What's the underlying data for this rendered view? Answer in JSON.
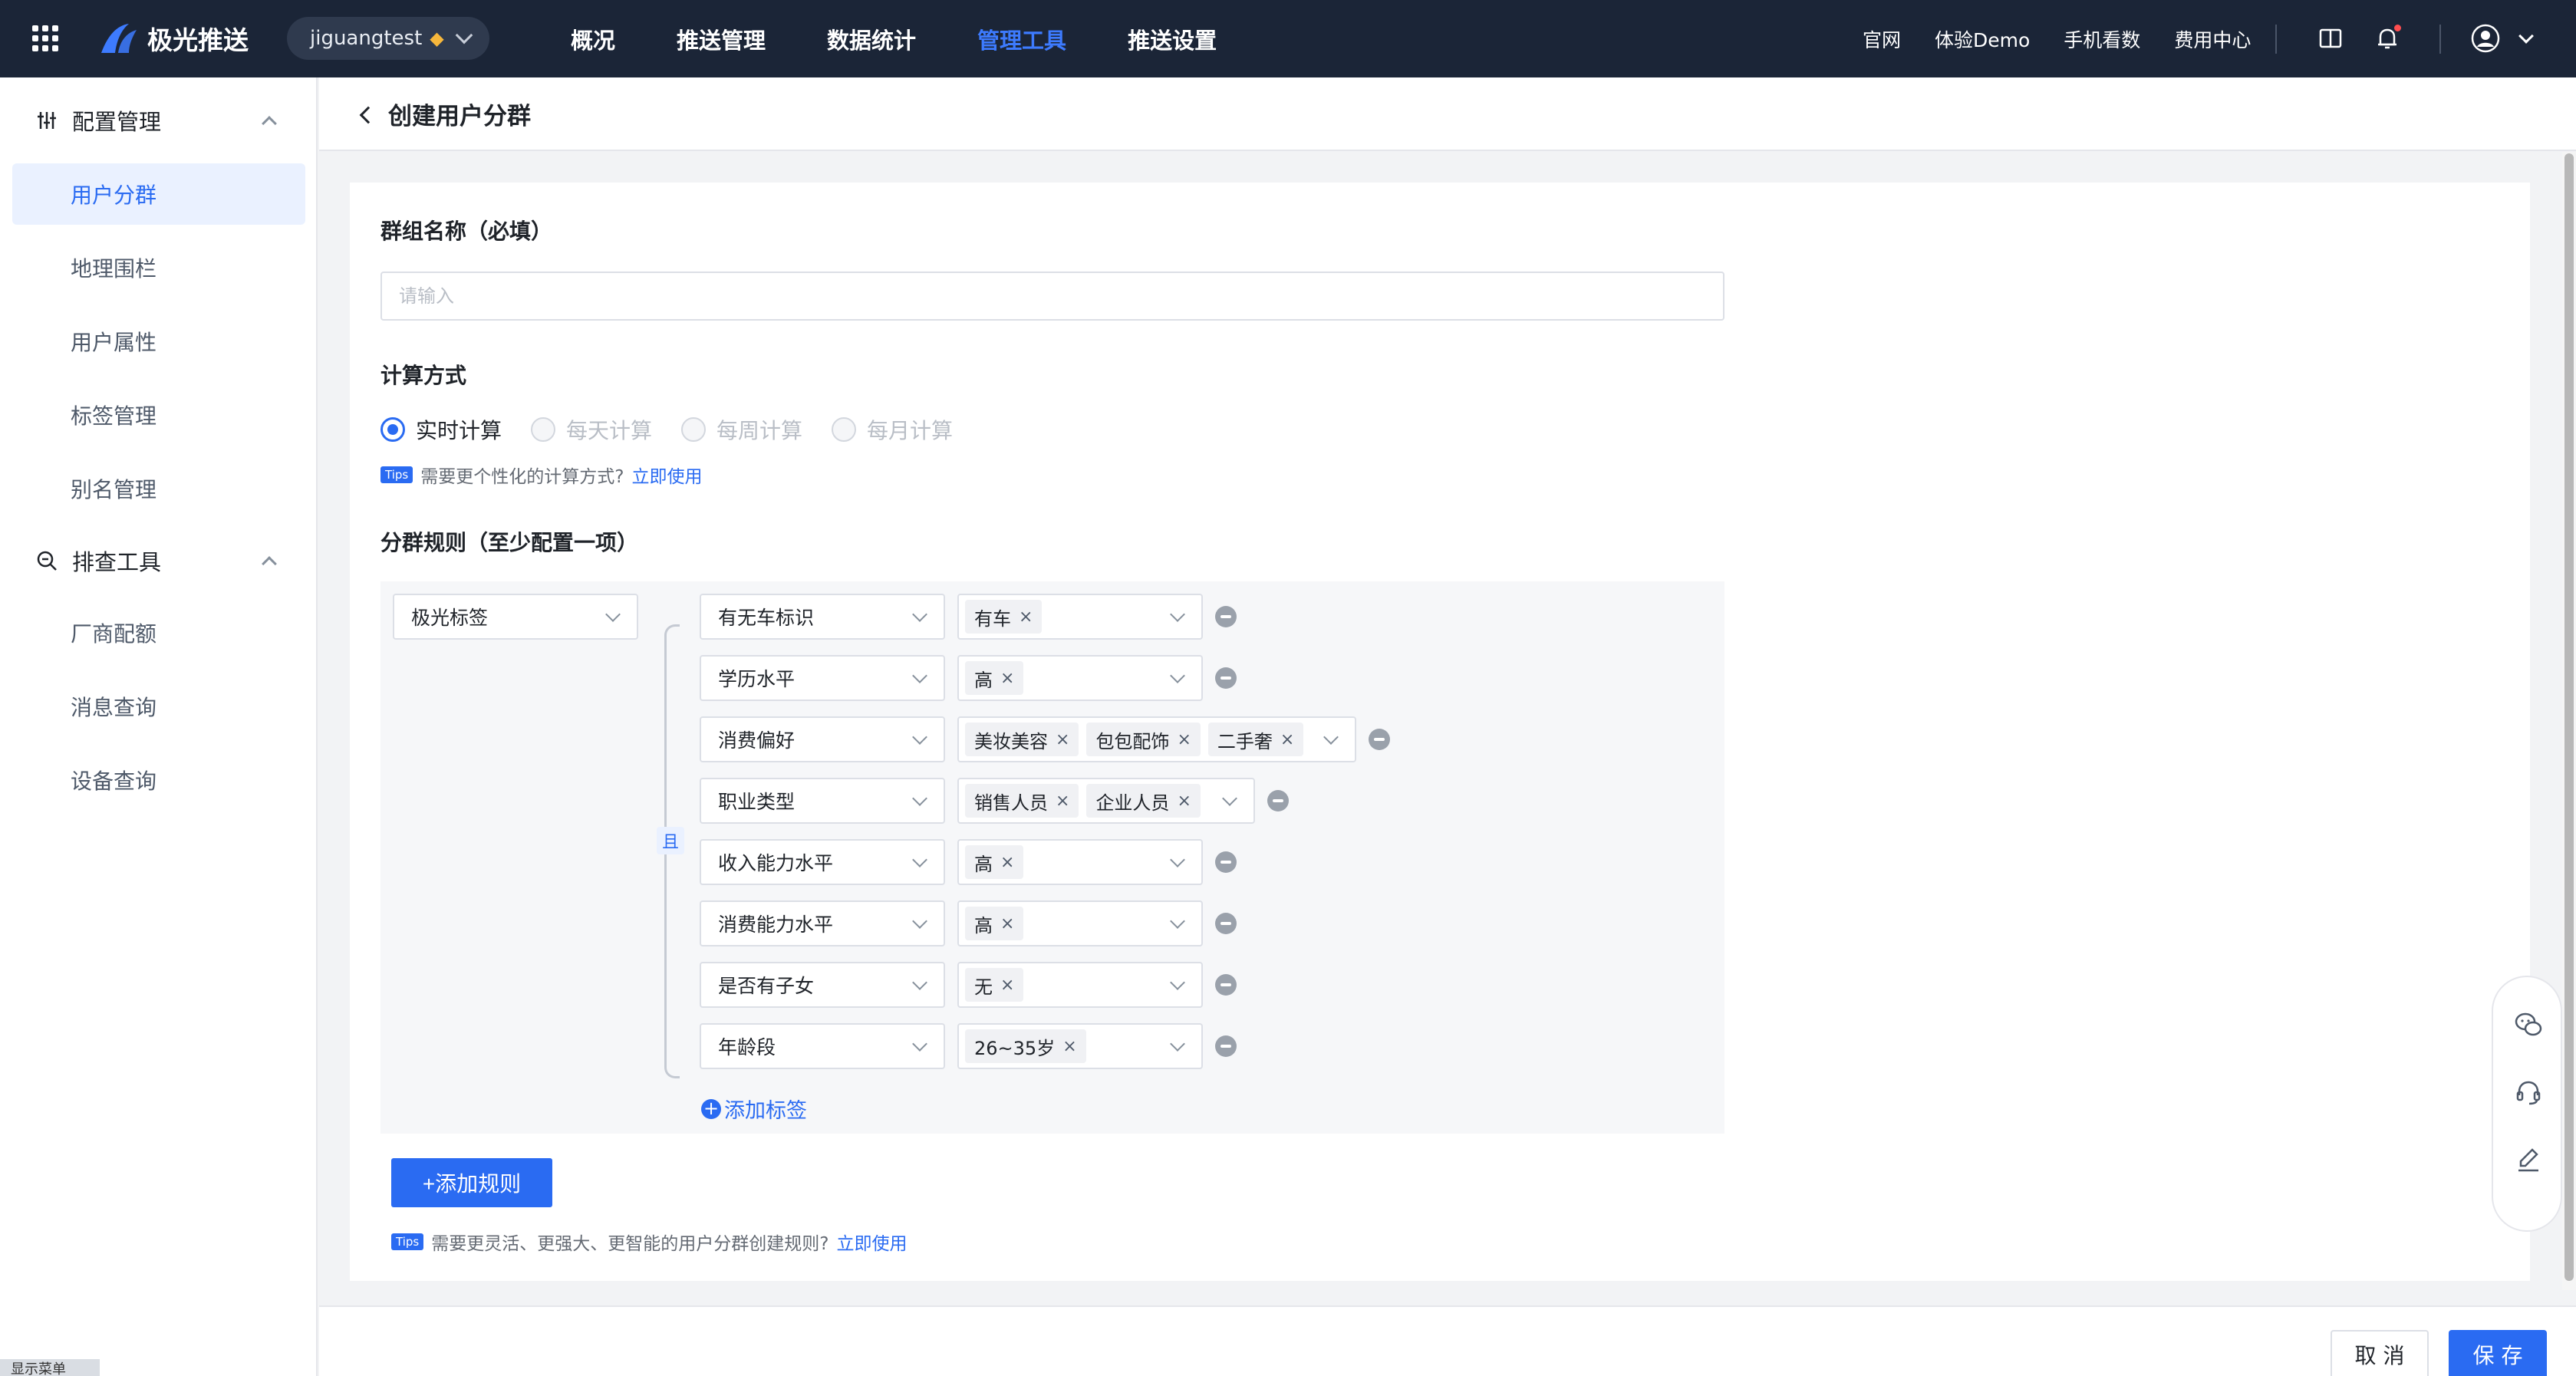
{
  "topbar": {
    "logo_text": "极光推送",
    "app_name": "jiguangtest",
    "nav": [
      "概况",
      "推送管理",
      "数据统计",
      "管理工具",
      "推送设置"
    ],
    "active_nav": "管理工具",
    "links": [
      "官网",
      "体验Demo",
      "手机看数",
      "费用中心"
    ],
    "icons": [
      "grid-menu-icon",
      "book-icon",
      "bell-icon",
      "user-avatar-icon"
    ],
    "colors": {
      "bg": "#1b2537",
      "accent": "#3d7bff"
    }
  },
  "sidebar": {
    "groups": [
      {
        "label": "配置管理",
        "icon": "sliders-icon",
        "items": [
          "用户分群",
          "地理围栏",
          "用户属性",
          "标签管理",
          "别名管理"
        ]
      },
      {
        "label": "排查工具",
        "icon": "search-zoom-icon",
        "items": [
          "厂商配额",
          "消息查询",
          "设备查询"
        ]
      }
    ],
    "active_item": "用户分群",
    "footer_text": "显示菜单"
  },
  "page": {
    "title": "创建用户分群"
  },
  "form": {
    "name_label": "群组名称（必填）",
    "name_placeholder": "请输入",
    "calc_label": "计算方式",
    "calc_options": [
      {
        "label": "实时计算",
        "checked": true,
        "disabled": false
      },
      {
        "label": "每天计算",
        "checked": false,
        "disabled": true
      },
      {
        "label": "每周计算",
        "checked": false,
        "disabled": true
      },
      {
        "label": "每月计算",
        "checked": false,
        "disabled": true
      }
    ],
    "tips1": {
      "badge": "Tips",
      "text": "需要更个性化的计算方式?",
      "link": "立即使用"
    },
    "rules_label": "分群规则（至少配置一项）",
    "rule_source": "极光标签",
    "and_label": "且",
    "rules": [
      {
        "field": "有无车标识",
        "values": [
          "有车"
        ]
      },
      {
        "field": "学历水平",
        "values": [
          "高"
        ]
      },
      {
        "field": "消费偏好",
        "values": [
          "美妆美容",
          "包包配饰",
          "二手奢"
        ]
      },
      {
        "field": "职业类型",
        "values": [
          "销售人员",
          "企业人员"
        ]
      },
      {
        "field": "收入能力水平",
        "values": [
          "高"
        ]
      },
      {
        "field": "消费能力水平",
        "values": [
          "高"
        ]
      },
      {
        "field": "是否有子女",
        "values": [
          "无"
        ]
      },
      {
        "field": "年龄段",
        "values": [
          "26~35岁"
        ]
      }
    ],
    "add_tag": "添加标签",
    "add_rule": "+添加规则",
    "tips2": {
      "badge": "Tips",
      "text": "需要更灵活、更强大、更智能的用户分群创建规则?",
      "link": "立即使用"
    }
  },
  "footer": {
    "cancel": "取 消",
    "save": "保 存"
  },
  "float_tools": [
    "wechat-chat-icon",
    "headset-icon",
    "edit-icon"
  ]
}
